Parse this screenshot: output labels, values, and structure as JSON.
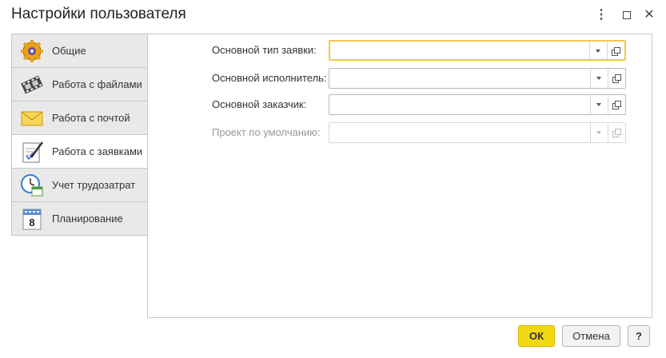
{
  "window": {
    "title": "Настройки пользователя",
    "more_icon": "⋮",
    "close_icon": "✕"
  },
  "tabs": [
    {
      "label": "Общие",
      "icon": "gear-icon"
    },
    {
      "label": "Работа с файлами",
      "icon": "film-icon"
    },
    {
      "label": "Работа с почтой",
      "icon": "envelope-icon"
    },
    {
      "label": "Работа с заявками",
      "icon": "clipboard-pen-icon",
      "active": true
    },
    {
      "label": "Учет трудозатрат",
      "icon": "clock-calendar-icon"
    },
    {
      "label": "Планирование",
      "icon": "calendar-icon",
      "calendar_day": "8"
    }
  ],
  "fields": [
    {
      "label": "Основной тип заявки:",
      "value": "",
      "focused": true
    },
    {
      "label": "Основной исполнитель:",
      "value": ""
    },
    {
      "label": "Основной заказчик:",
      "value": ""
    },
    {
      "label": "Проект по умолчанию:",
      "value": "",
      "disabled": true
    }
  ],
  "buttons": {
    "ok": "ОК",
    "cancel": "Отмена",
    "help": "?"
  },
  "colors": {
    "accent": "#f4d80f",
    "focus": "#f1c84a"
  }
}
